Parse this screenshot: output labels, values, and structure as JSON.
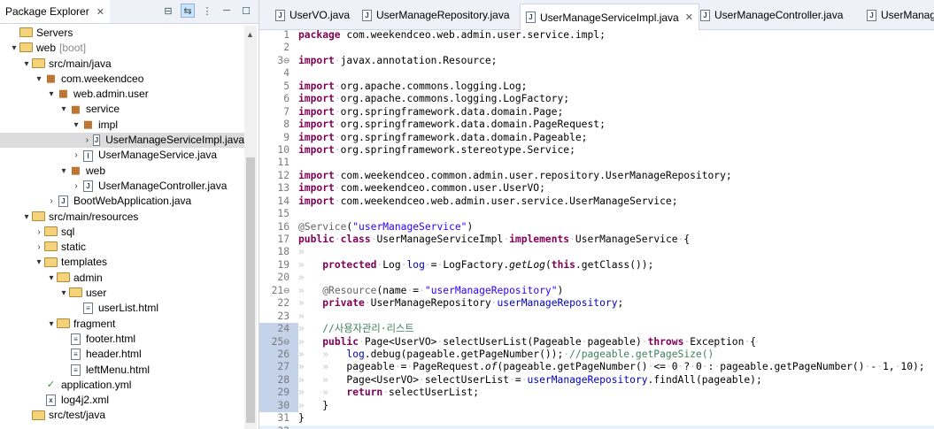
{
  "explorer": {
    "title": "Package Explorer",
    "tree": [
      {
        "label": "Servers",
        "depth": 0,
        "icon": "folder-icon",
        "chevron": ""
      },
      {
        "label": "web",
        "suffix": "[boot]",
        "depth": 0,
        "icon": "project-icon",
        "chevron": "▾"
      },
      {
        "label": "src/main/java",
        "depth": 1,
        "icon": "source-folder-icon",
        "chevron": "▾"
      },
      {
        "label": "com.weekendceo",
        "depth": 2,
        "icon": "package-icon",
        "chevron": "▾"
      },
      {
        "label": "web.admin.user",
        "depth": 3,
        "icon": "package-icon",
        "chevron": "▾"
      },
      {
        "label": "service",
        "depth": 4,
        "icon": "package-icon",
        "chevron": "▾"
      },
      {
        "label": "impl",
        "depth": 5,
        "icon": "package-icon",
        "chevron": "▾"
      },
      {
        "label": "UserManageServiceImpl.java",
        "depth": 6,
        "icon": "java-file-icon",
        "chevron": "›",
        "selected": true
      },
      {
        "label": "UserManageService.java",
        "depth": 5,
        "icon": "java-interface-icon",
        "chevron": "›"
      },
      {
        "label": "web",
        "depth": 4,
        "icon": "package-icon",
        "chevron": "▾"
      },
      {
        "label": "UserManageController.java",
        "depth": 5,
        "icon": "java-file-icon",
        "chevron": "›"
      },
      {
        "label": "BootWebApplication.java",
        "depth": 3,
        "icon": "java-file-icon",
        "chevron": "›"
      },
      {
        "label": "src/main/resources",
        "depth": 1,
        "icon": "source-folder-icon",
        "chevron": "▾"
      },
      {
        "label": "sql",
        "depth": 2,
        "icon": "folder-icon",
        "chevron": "›"
      },
      {
        "label": "static",
        "depth": 2,
        "icon": "folder-icon",
        "chevron": "›"
      },
      {
        "label": "templates",
        "depth": 2,
        "icon": "folder-icon",
        "chevron": "▾"
      },
      {
        "label": "admin",
        "depth": 3,
        "icon": "folder-icon",
        "chevron": "▾"
      },
      {
        "label": "user",
        "depth": 4,
        "icon": "folder-icon",
        "chevron": "▾"
      },
      {
        "label": "userList.html",
        "depth": 5,
        "icon": "html-file-icon",
        "chevron": ""
      },
      {
        "label": "fragment",
        "depth": 3,
        "icon": "folder-icon",
        "chevron": "▾"
      },
      {
        "label": "footer.html",
        "depth": 4,
        "icon": "html-file-icon",
        "chevron": ""
      },
      {
        "label": "header.html",
        "depth": 4,
        "icon": "html-file-icon",
        "chevron": ""
      },
      {
        "label": "leftMenu.html",
        "depth": 4,
        "icon": "html-file-icon",
        "chevron": ""
      },
      {
        "label": "application.yml",
        "depth": 2,
        "icon": "yml-file-icon",
        "chevron": ""
      },
      {
        "label": "log4j2.xml",
        "depth": 2,
        "icon": "xml-file-icon",
        "chevron": ""
      },
      {
        "label": "src/test/java",
        "depth": 1,
        "icon": "source-folder-icon",
        "chevron": ""
      }
    ]
  },
  "editor": {
    "tabs": [
      {
        "label": "UserVO.java",
        "active": false
      },
      {
        "label": "UserManageRepository.java",
        "active": false
      },
      {
        "label": "UserManageServiceImpl.java",
        "active": true
      },
      {
        "label": "UserManageController.java",
        "active": false
      },
      {
        "label": "UserManag",
        "active": false
      }
    ],
    "lines": [
      {
        "n": "1",
        "html": "<span class='kw'>package</span> com.weekendceo.web.admin.user.service.impl;"
      },
      {
        "n": "2",
        "html": ""
      },
      {
        "n": "3⊖",
        "html": "<span class='kw'>import</span><span class='ws'>·</span>javax.annotation.Resource;"
      },
      {
        "n": "4",
        "html": ""
      },
      {
        "n": "5",
        "html": "<span class='kw'>import</span><span class='ws'>·</span>org.apache.commons.logging.Log;"
      },
      {
        "n": "6",
        "html": "<span class='kw'>import</span><span class='ws'>·</span>org.apache.commons.logging.LogFactory;"
      },
      {
        "n": "7",
        "html": "<span class='kw'>import</span><span class='ws'>·</span>org.springframework.data.domain.Page;"
      },
      {
        "n": "8",
        "html": "<span class='kw'>import</span><span class='ws'>·</span>org.springframework.data.domain.PageRequest;"
      },
      {
        "n": "9",
        "html": "<span class='kw'>import</span><span class='ws'>·</span>org.springframework.data.domain.Pageable;"
      },
      {
        "n": "10",
        "html": "<span class='kw'>import</span><span class='ws'>·</span>org.springframework.stereotype.Service;"
      },
      {
        "n": "11",
        "html": ""
      },
      {
        "n": "12",
        "html": "<span class='kw'>import</span><span class='ws'>·</span>com.weekendceo.common.admin.user.repository.UserManageRepository;"
      },
      {
        "n": "13",
        "html": "<span class='kw'>import</span><span class='ws'>·</span>com.weekendceo.common.user.UserVO;"
      },
      {
        "n": "14",
        "html": "<span class='kw'>import</span><span class='ws'>·</span>com.weekendceo.web.admin.user.service.UserManageService;"
      },
      {
        "n": "15",
        "html": ""
      },
      {
        "n": "16",
        "html": "<span class='an'>@Service</span>(<span class='st'>\"userManageService\"</span>)"
      },
      {
        "n": "17",
        "html": "<span class='kw'>public</span><span class='ws'>·</span><span class='kw'>class</span><span class='ws'>·</span>UserManageServiceImpl<span class='ws'>·</span><span class='kw'>implements</span><span class='ws'>·</span>UserManageService<span class='ws'>·</span>{"
      },
      {
        "n": "18",
        "html": "<span class='ws'>»</span>"
      },
      {
        "n": "19",
        "html": "<span class='ws'>»   </span><span class='kw'>protected</span><span class='ws'>·</span>Log<span class='ws'>·</span><span class='fd'>log</span><span class='ws'>·</span>=<span class='ws'>·</span>LogFactory.<span class='it'>getLog</span>(<span class='kw'>this</span>.getClass());"
      },
      {
        "n": "20",
        "html": "<span class='ws'>»</span>"
      },
      {
        "n": "21⊖",
        "html": "<span class='ws'>»   </span><span class='an'>@Resource</span>(name<span class='ws'>·</span>=<span class='ws'>·</span><span class='st'>\"userManageRepository\"</span>)"
      },
      {
        "n": "22",
        "html": "<span class='ws'>»   </span><span class='kw'>private</span><span class='ws'>·</span>UserManageRepository<span class='ws'>·</span><span class='fd'>userManageRepository</span>;"
      },
      {
        "n": "23",
        "html": "<span class='ws'>»</span>"
      },
      {
        "n": "24",
        "html": "<span class='ws'>»   </span><span class='cm'>//사용자관리·리스트</span>",
        "mark": true
      },
      {
        "n": "25⊖",
        "html": "<span class='ws'>»   </span><span class='kw'>public</span><span class='ws'>·</span>Page&lt;UserVO&gt;<span class='ws'>·</span>selectUserList(Pageable<span class='ws'>·</span>pageable)<span class='ws'>·</span><span class='kw'>throws</span><span class='ws'>·</span>Exception<span class='ws'>·</span>{",
        "mark": true
      },
      {
        "n": "26",
        "html": "<span class='ws'>»   »   </span><span class='fd'>log</span>.debug(pageable.getPageNumber());<span class='ws'>·</span><span class='cm'>//pageable.getPageSize()</span>",
        "mark": true
      },
      {
        "n": "27",
        "html": "<span class='ws'>»   »   </span>pageable<span class='ws'>·</span>=<span class='ws'>·</span>PageRequest.<span class='it'>of</span>(pageable.getPageNumber()<span class='ws'>·</span>&lt;=<span class='ws'>·</span>0<span class='ws'>·</span>?<span class='ws'>·</span>0<span class='ws'>·</span>:<span class='ws'>·</span>pageable.getPageNumber()<span class='ws'>·</span>-<span class='ws'>·</span>1,<span class='ws'>·</span>10);",
        "mark": true
      },
      {
        "n": "28",
        "html": "<span class='ws'>»   »   </span>Page&lt;UserVO&gt;<span class='ws'>·</span>selectUserList<span class='ws'>·</span>=<span class='ws'>·</span><span class='fd'>userManageRepository</span>.findAll(pageable);",
        "mark": true
      },
      {
        "n": "29",
        "html": "<span class='ws'>»   »   </span><span class='kw'>return</span><span class='ws'>·</span>selectUserList;",
        "mark": true
      },
      {
        "n": "30",
        "html": "<span class='ws'>»   </span>}",
        "mark": true
      },
      {
        "n": "31",
        "html": "}"
      },
      {
        "n": "32",
        "html": "",
        "cursor": true
      }
    ]
  }
}
